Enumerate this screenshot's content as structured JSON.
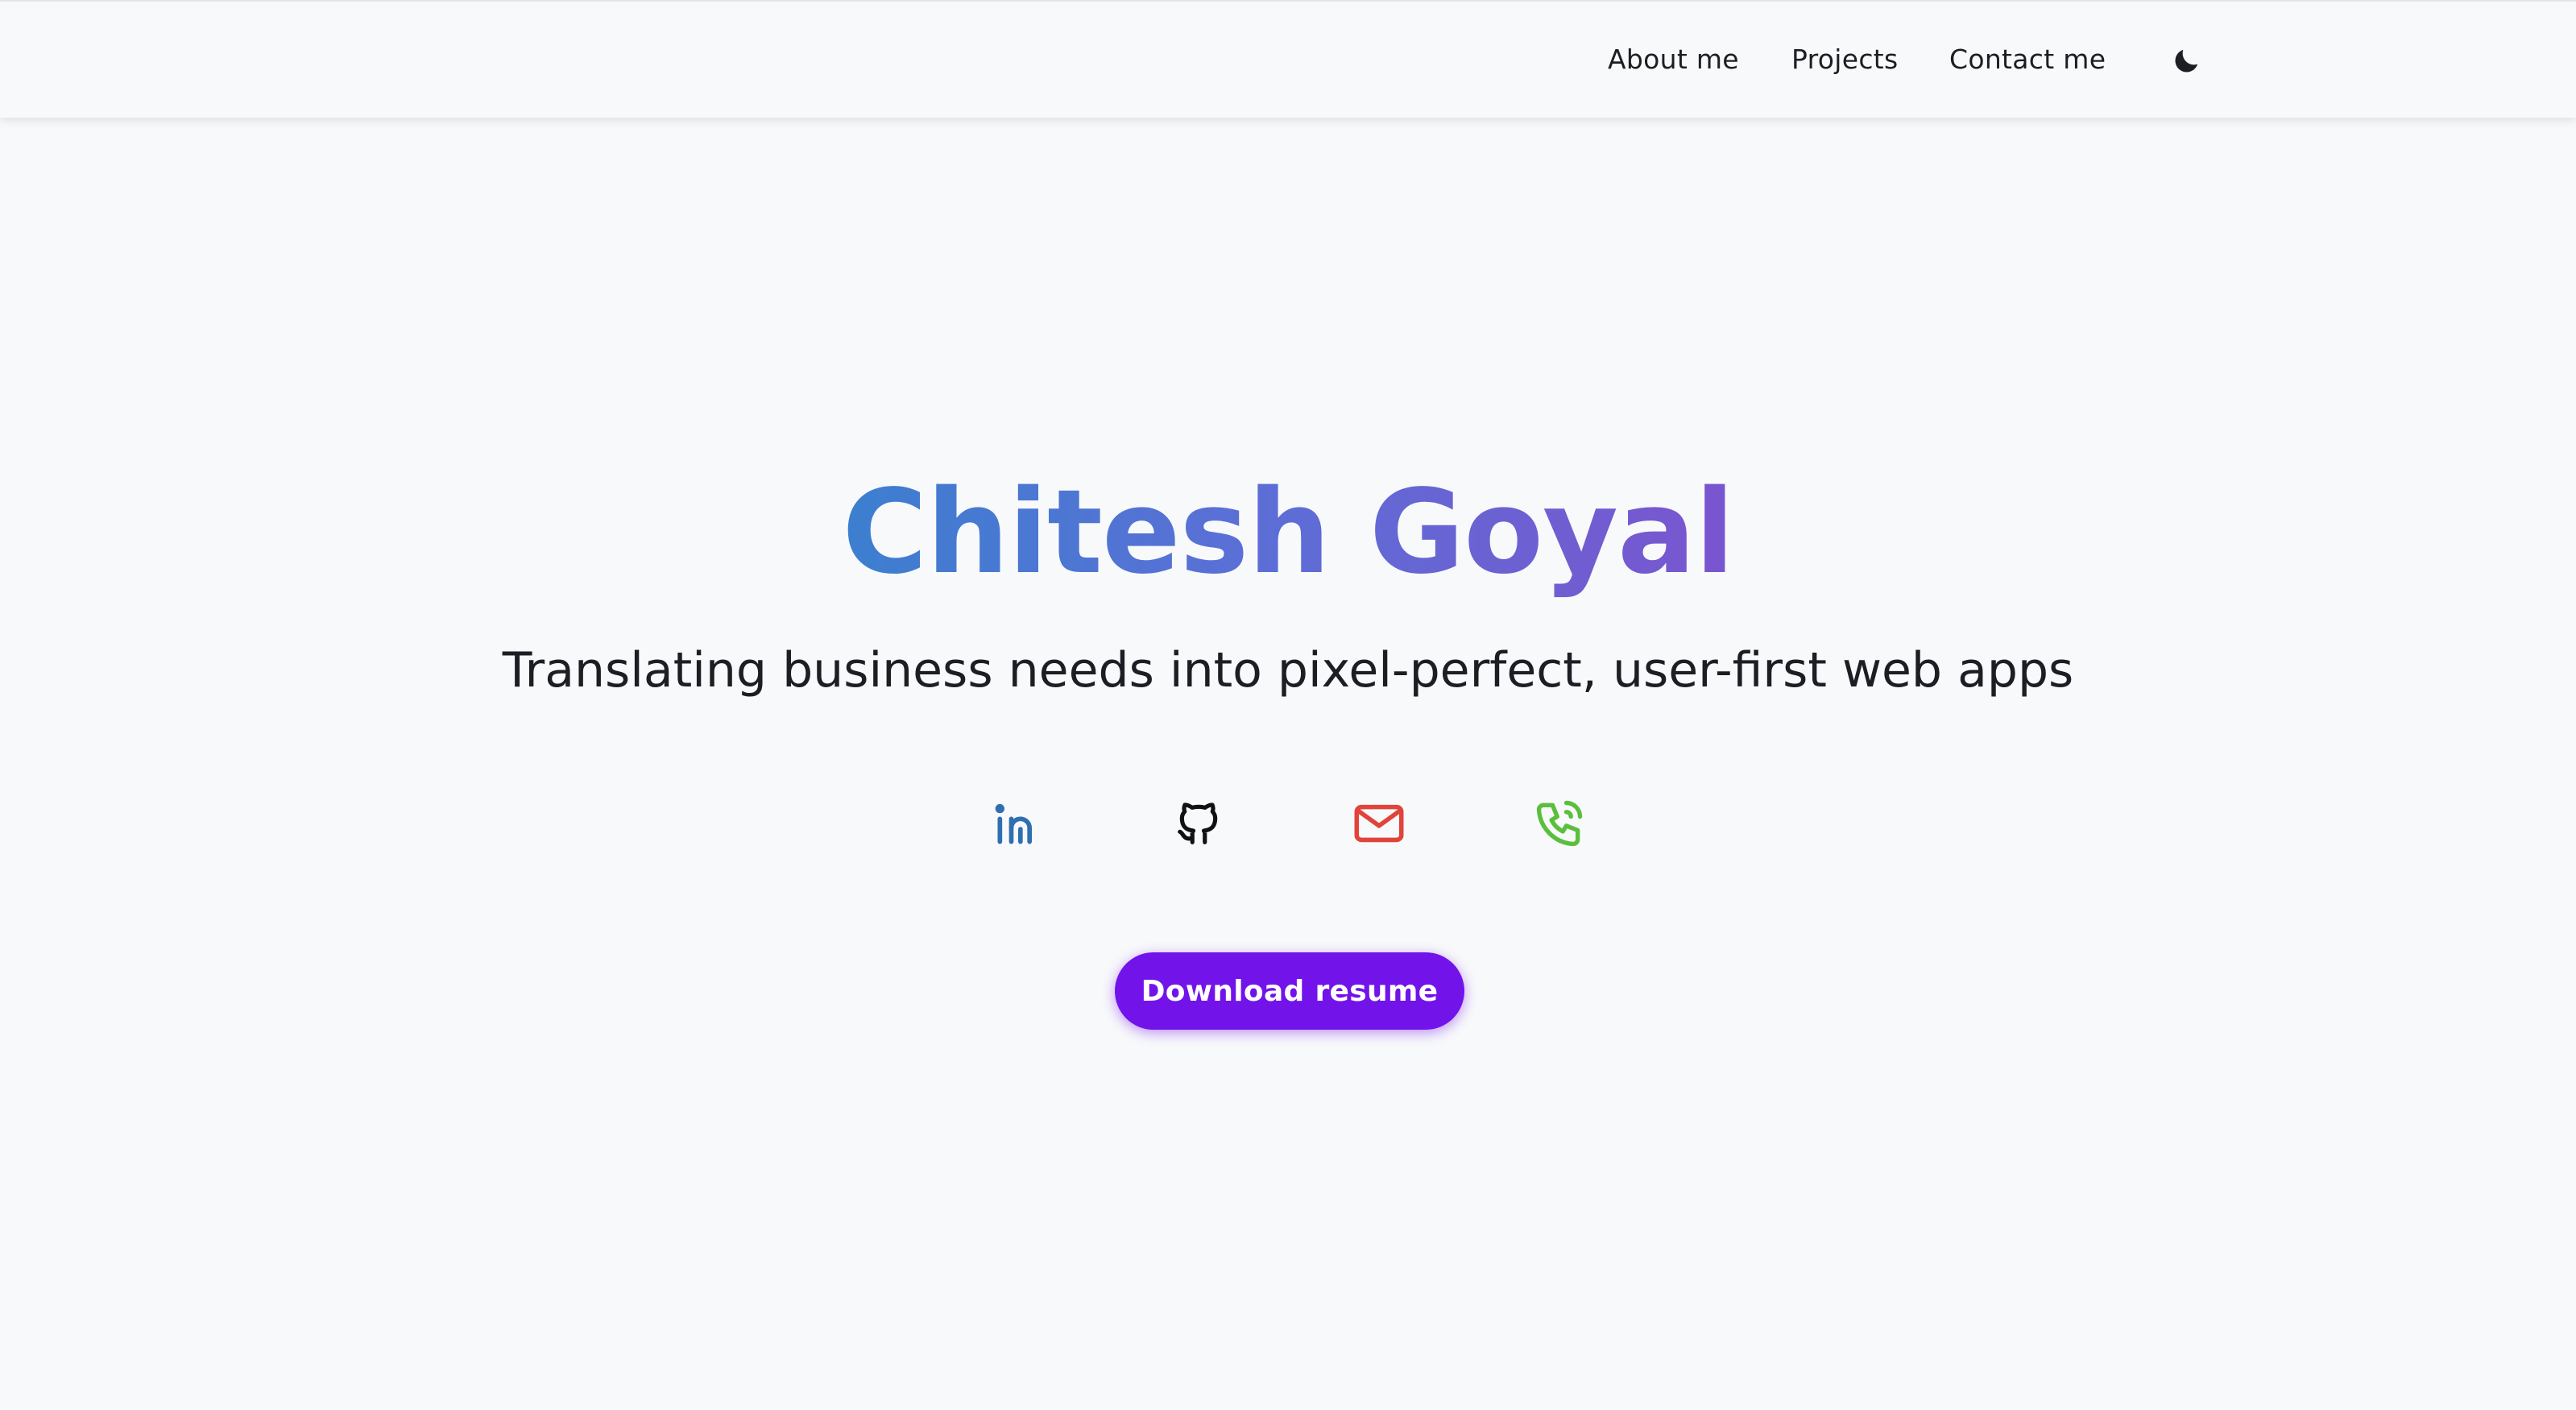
{
  "nav": {
    "about_label": "About me",
    "projects_label": "Projects",
    "contact_label": "Contact me",
    "theme_toggle_icon": "moon-icon"
  },
  "hero": {
    "title": "Chitesh Goyal",
    "subtitle": "Translating business needs into pixel-perfect, user-first web apps"
  },
  "social": [
    {
      "icon": "linkedin-icon",
      "color": "#2f6fb0"
    },
    {
      "icon": "github-icon",
      "color": "#111111"
    },
    {
      "icon": "mail-icon",
      "color": "#e0443a"
    },
    {
      "icon": "phone-icon",
      "color": "#5bbf3d"
    }
  ],
  "cta": {
    "download_label": "Download resume",
    "color": "#7213ea"
  },
  "colors": {
    "background": "#f8f9fb",
    "title_gradient_start": "#3c7fcf",
    "title_gradient_end": "#7a55cf",
    "text": "#1d1e24"
  }
}
